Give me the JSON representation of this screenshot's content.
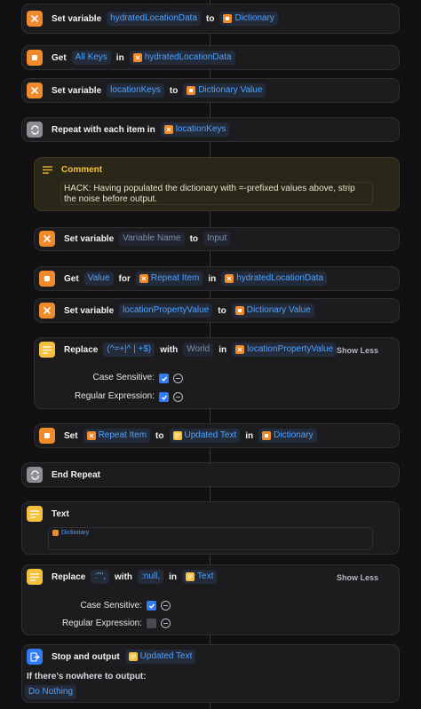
{
  "colors": {
    "accent": "#4ea3ff",
    "variable": "#f08a2b",
    "text_action": "#f5c13c",
    "comment_title": "#f5c13c",
    "output_action": "#2f7cf6"
  },
  "actions": {
    "set_hydrated": {
      "verb": "Set variable",
      "var": "hydratedLocationData",
      "to": "to",
      "value": "Dictionary"
    },
    "get_keys": {
      "verb": "Get",
      "what": "All Keys",
      "in": "in",
      "src": "hydratedLocationData"
    },
    "set_keys": {
      "verb": "Set variable",
      "var": "locationKeys",
      "to": "to",
      "value": "Dictionary Value"
    },
    "repeat": {
      "verb": "Repeat with each item in",
      "src": "locationKeys"
    },
    "comment": {
      "title": "Comment",
      "body": "HACK: Having populated the dictionary with =-prefixed values above, strip the noise before output."
    },
    "set_varname": {
      "verb": "Set variable",
      "var": "Variable Name",
      "to": "to",
      "value": "Input"
    },
    "get_value": {
      "verb": "Get",
      "what": "Value",
      "for": "for",
      "key": "Repeat Item",
      "in": "in",
      "src": "hydratedLocationData"
    },
    "set_prop": {
      "verb": "Set variable",
      "var": "locationPropertyValue",
      "to": "to",
      "value": "Dictionary Value"
    },
    "replace1": {
      "verb": "Replace",
      "pattern": "(^=+|^ | +$)",
      "with": "with",
      "replacement": "World",
      "in": "in",
      "src": "locationPropertyValue",
      "toggle": "Show Less",
      "case_label": "Case Sensitive:",
      "regex_label": "Regular Expression:"
    },
    "set_dict": {
      "verb": "Set",
      "key": "Repeat Item",
      "to": "to",
      "value": "Updated Text",
      "in": "in",
      "dict": "Dictionary"
    },
    "end_repeat": {
      "verb": "End Repeat"
    },
    "text": {
      "verb": "Text",
      "content": "Dictionary"
    },
    "replace2": {
      "verb": "Replace",
      "pattern": ":\"\",",
      "with": "with",
      "replacement": ":null,",
      "in": "in",
      "src": "Text",
      "toggle": "Show Less",
      "case_label": "Case Sensitive:",
      "regex_label": "Regular Expression:"
    },
    "stop": {
      "verb": "Stop and output",
      "value": "Updated Text",
      "fallback_label": "If there's nowhere to output:",
      "fallback_value": "Do Nothing"
    }
  },
  "checkboxes": {
    "replace1_case": true,
    "replace1_regex": true,
    "replace2_case": true,
    "replace2_regex": false
  },
  "icons": {
    "variable": "variable-x-icon",
    "get": "dictionary-icon",
    "repeat": "repeat-icon",
    "comment": "lines-icon",
    "text": "text-icon",
    "output": "output-arrow-icon",
    "info": "minus-circle-icon"
  }
}
